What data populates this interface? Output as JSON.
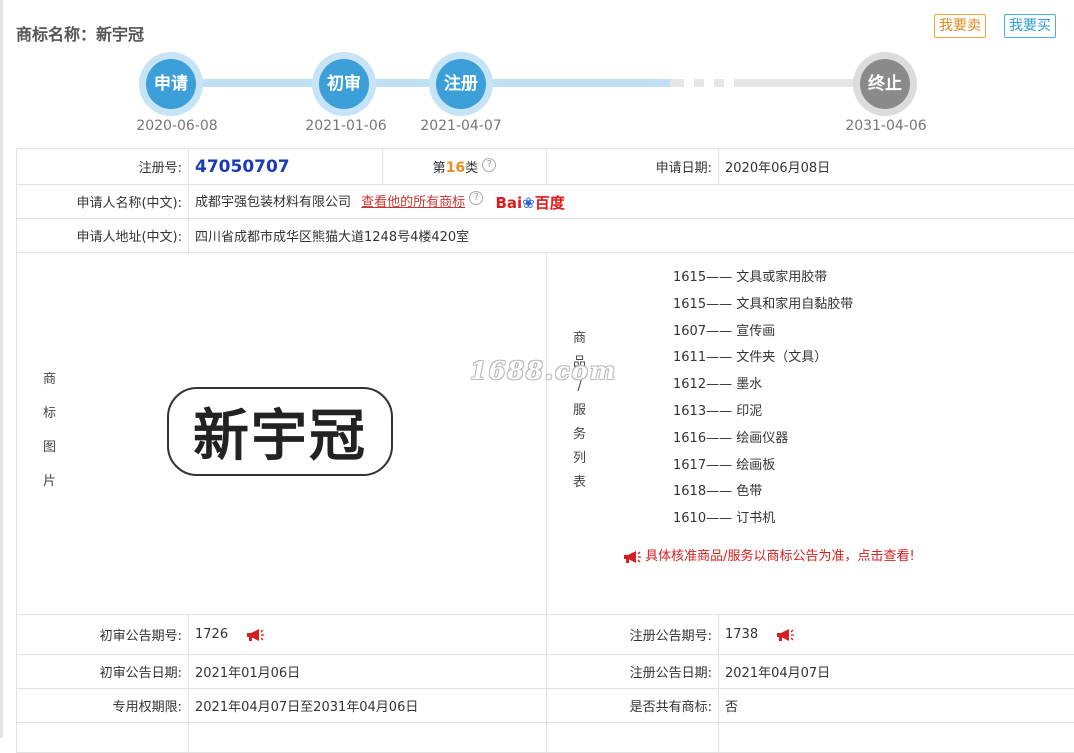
{
  "header": {
    "title_label": "商标名称：",
    "title_value": "新宇冠",
    "sell_button": "我要卖",
    "buy_button": "我要买"
  },
  "timeline": [
    {
      "label": "申请",
      "date": "2020-06-08",
      "state": "done"
    },
    {
      "label": "初审",
      "date": "2021-01-06",
      "state": "done"
    },
    {
      "label": "注册",
      "date": "2021-04-07",
      "state": "done"
    },
    {
      "label": "终止",
      "date": "2031-04-06",
      "state": "pending"
    }
  ],
  "details": {
    "reg_no_label": "注册号:",
    "reg_no": "47050707",
    "class_prefix": "第",
    "class_num": "16",
    "class_suffix": "类",
    "apply_date_label": "申请日期:",
    "apply_date": "2020年06月08日",
    "applicant_label": "申请人名称(中文):",
    "applicant": "成都宇强包装材料有限公司",
    "see_all_link": "查看他的所有商标",
    "baidu_text": "Bai",
    "baidu_suffix": "百度",
    "address_label": "申请人地址(中文):",
    "address": "四川省成都市成华区熊猫大道1248号4楼420室",
    "image_label": [
      "商",
      "标",
      "图",
      "片"
    ],
    "trademark_text": "新宇冠",
    "goods_label": [
      "商",
      "品",
      "/",
      "服",
      "务",
      "列",
      "表"
    ],
    "goods": [
      "1615—— 文具或家用胶带",
      "1615—— 文具和家用自黏胶带",
      "1607—— 宣传画",
      "1611—— 文件夹（文具）",
      "1612—— 墨水",
      "1613—— 印泥",
      "1616—— 绘画仪器",
      "1617—— 绘画板",
      "1618—— 色带",
      "1610—— 订书机"
    ],
    "goods_notice": "具体核准商品/服务以商标公告为准，点击查看!",
    "prelim_no_label": "初审公告期号:",
    "prelim_no": "1726",
    "reg_pub_no_label": "注册公告期号:",
    "reg_pub_no": "1738",
    "prelim_date_label": "初审公告日期:",
    "prelim_date": "2021年01月06日",
    "reg_pub_date_label": "注册公告日期:",
    "reg_pub_date": "2021年04月07日",
    "term_label": "专用权期限:",
    "term": "2021年04月07日至2031年04月06日",
    "shared_label": "是否共有商标:",
    "shared": "否"
  },
  "watermark": "1688.com",
  "colors": {
    "accent_blue": "#3c9fd8",
    "track_blue": "#bfe0f5",
    "regno": "#1a3ab8",
    "alert_red": "#d42020"
  }
}
